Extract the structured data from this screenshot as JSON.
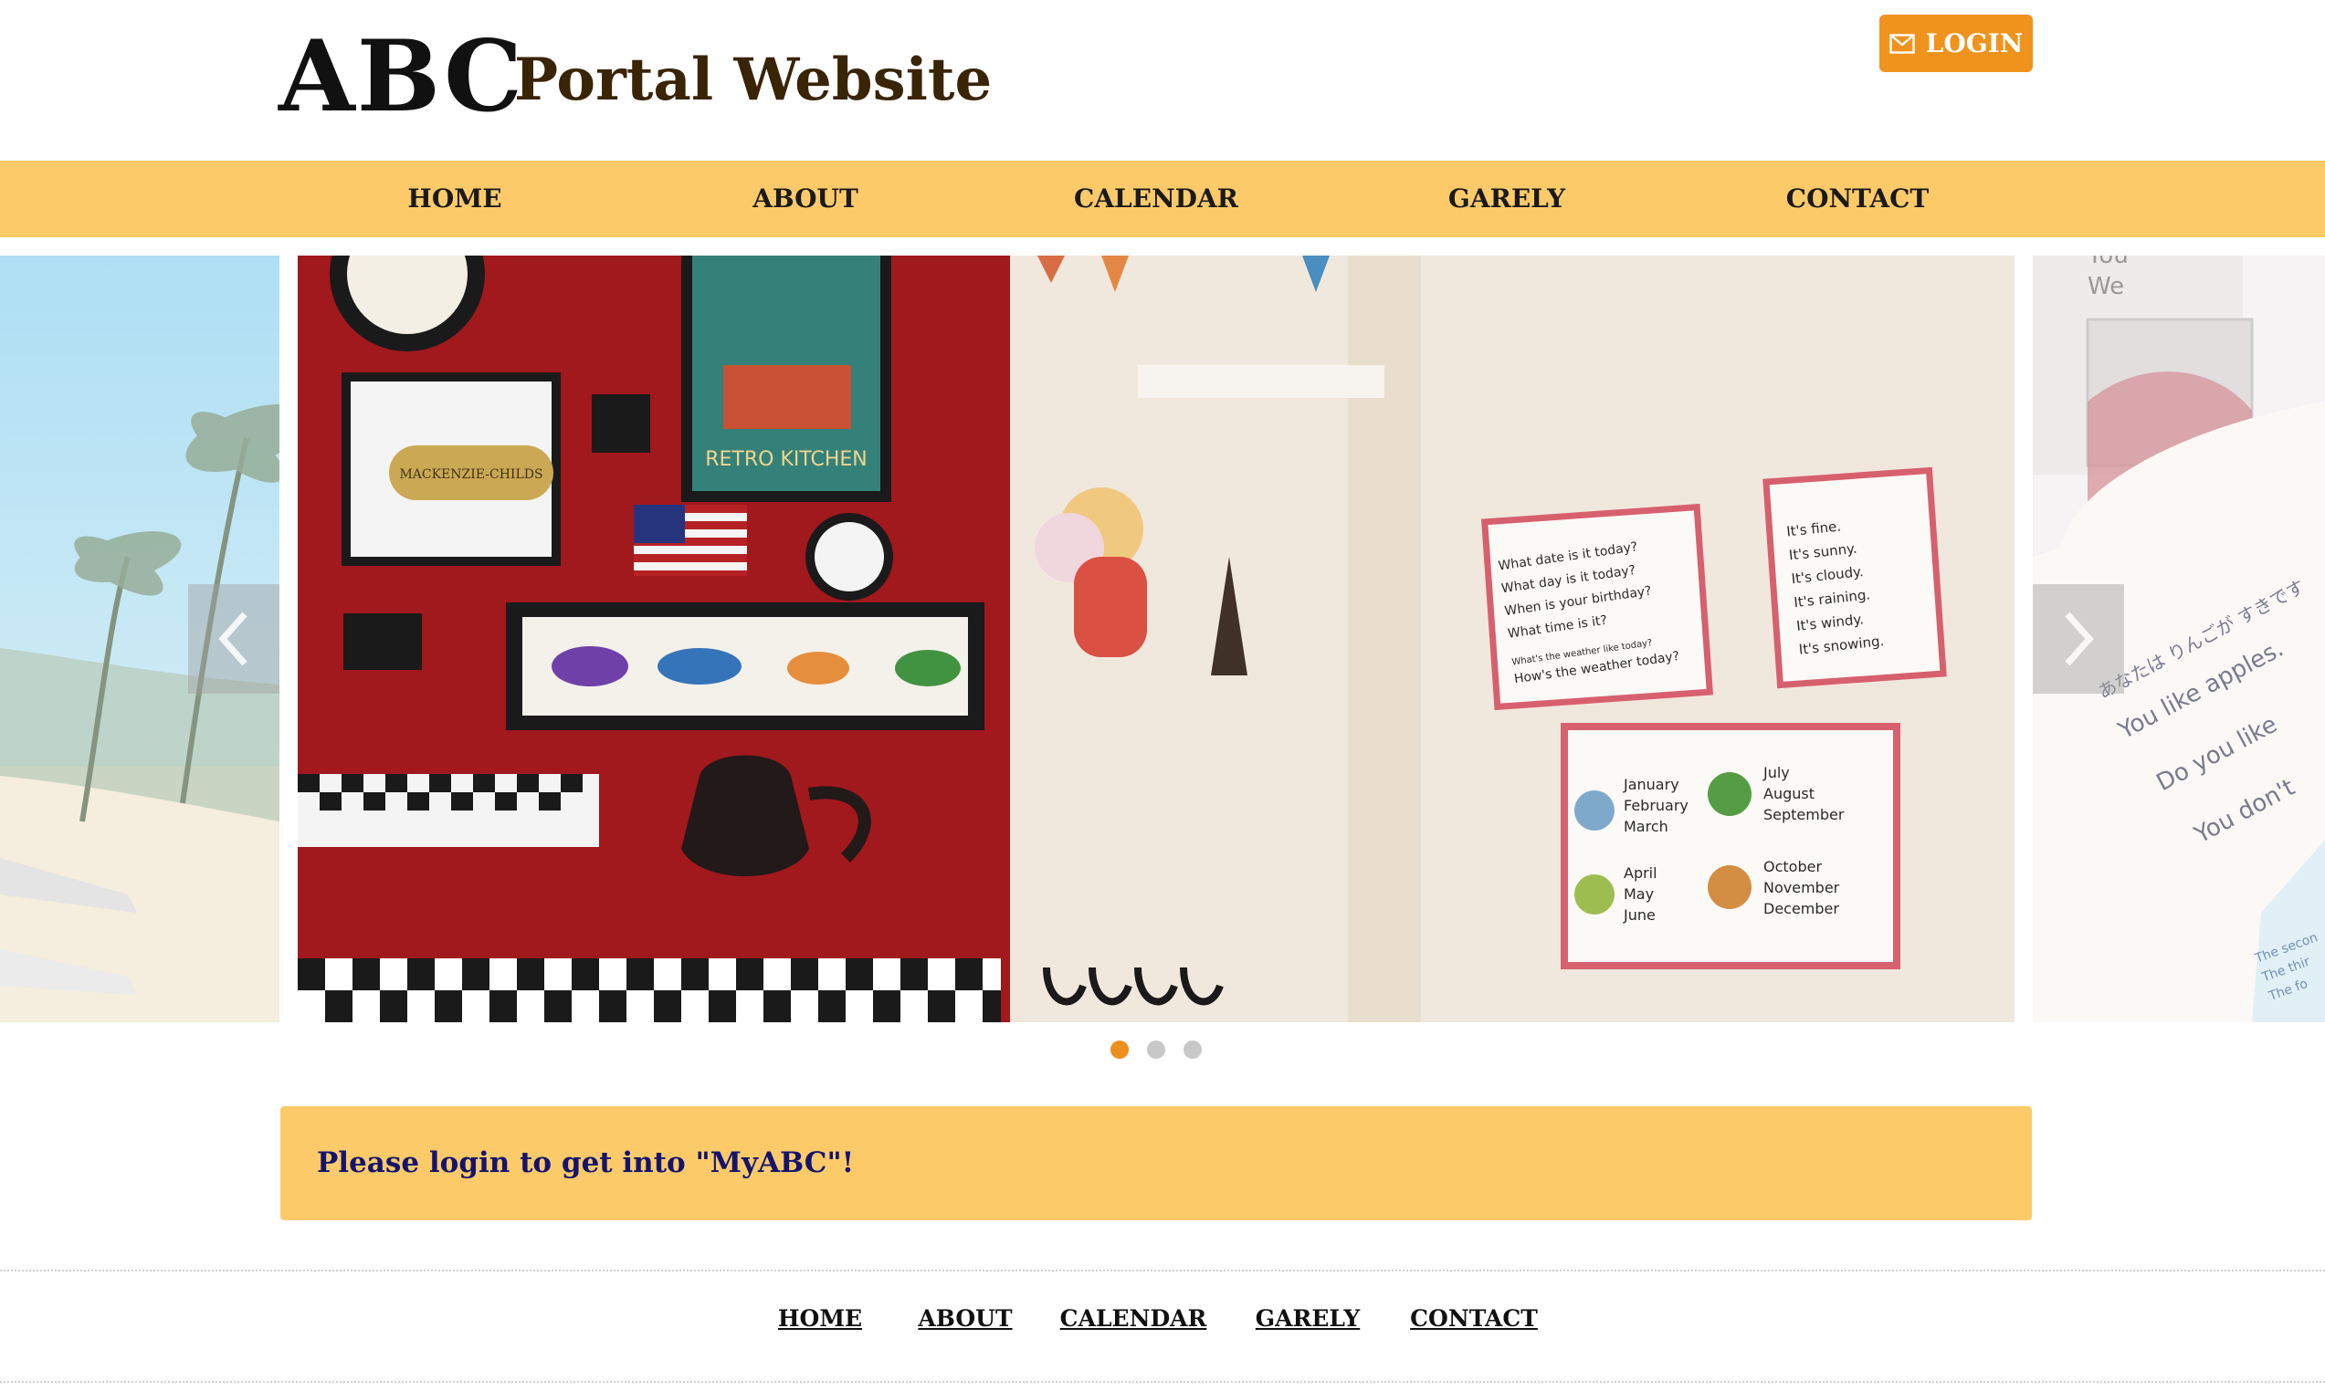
{
  "header": {
    "logo": "ABC",
    "subtitle": "Portal Website",
    "login_label": "LOGIN"
  },
  "nav": {
    "items": [
      "HOME",
      "ABOUT",
      "CALENDAR",
      "GARELY",
      "CONTACT"
    ]
  },
  "carousel": {
    "slide_count": 3,
    "active_index": 0,
    "slides": [
      {
        "image": "classroom-wall",
        "poster_kitchen": "RETRO KITCHEN",
        "poster_kitchen_brand": "MACKENZIE-CHILDS",
        "chart_questions": [
          "What date is it today?",
          "What day is it today?",
          "When is your birthday?",
          "What time is it?",
          "What's the weather like today?",
          "How's the weather today?"
        ],
        "chart_weather": [
          "It's fine.",
          "It's sunny.",
          "It's cloudy.",
          "It's raining.",
          "It's windy.",
          "It's snowing."
        ],
        "chart_months": [
          "January",
          "February",
          "March",
          "April",
          "May",
          "June",
          "July",
          "August",
          "September",
          "October",
          "November",
          "December"
        ]
      },
      {
        "image": "beach-palms"
      },
      {
        "image": "english-worksheet",
        "worksheet_lines": [
          "You",
          "We",
          "あなたは りんごが すきです",
          "You like apples.",
          "Do you like",
          "You don't",
          "The secon",
          "The thir",
          "The fo"
        ]
      }
    ],
    "prev_icon": "chevron-left-icon",
    "next_icon": "chevron-right-icon"
  },
  "notice": {
    "text": "Please login to get into \"MyABC\"!"
  },
  "footer": {
    "links": [
      "HOME",
      "ABOUT",
      "CALENDAR",
      "GARELY",
      "CONTACT"
    ]
  },
  "colors": {
    "nav_bg": "#fdca6a",
    "accent": "#f0931c",
    "notice_text": "#14146e",
    "dot_active": "#ec8f1d",
    "dot_inactive": "#c8c8c8"
  }
}
